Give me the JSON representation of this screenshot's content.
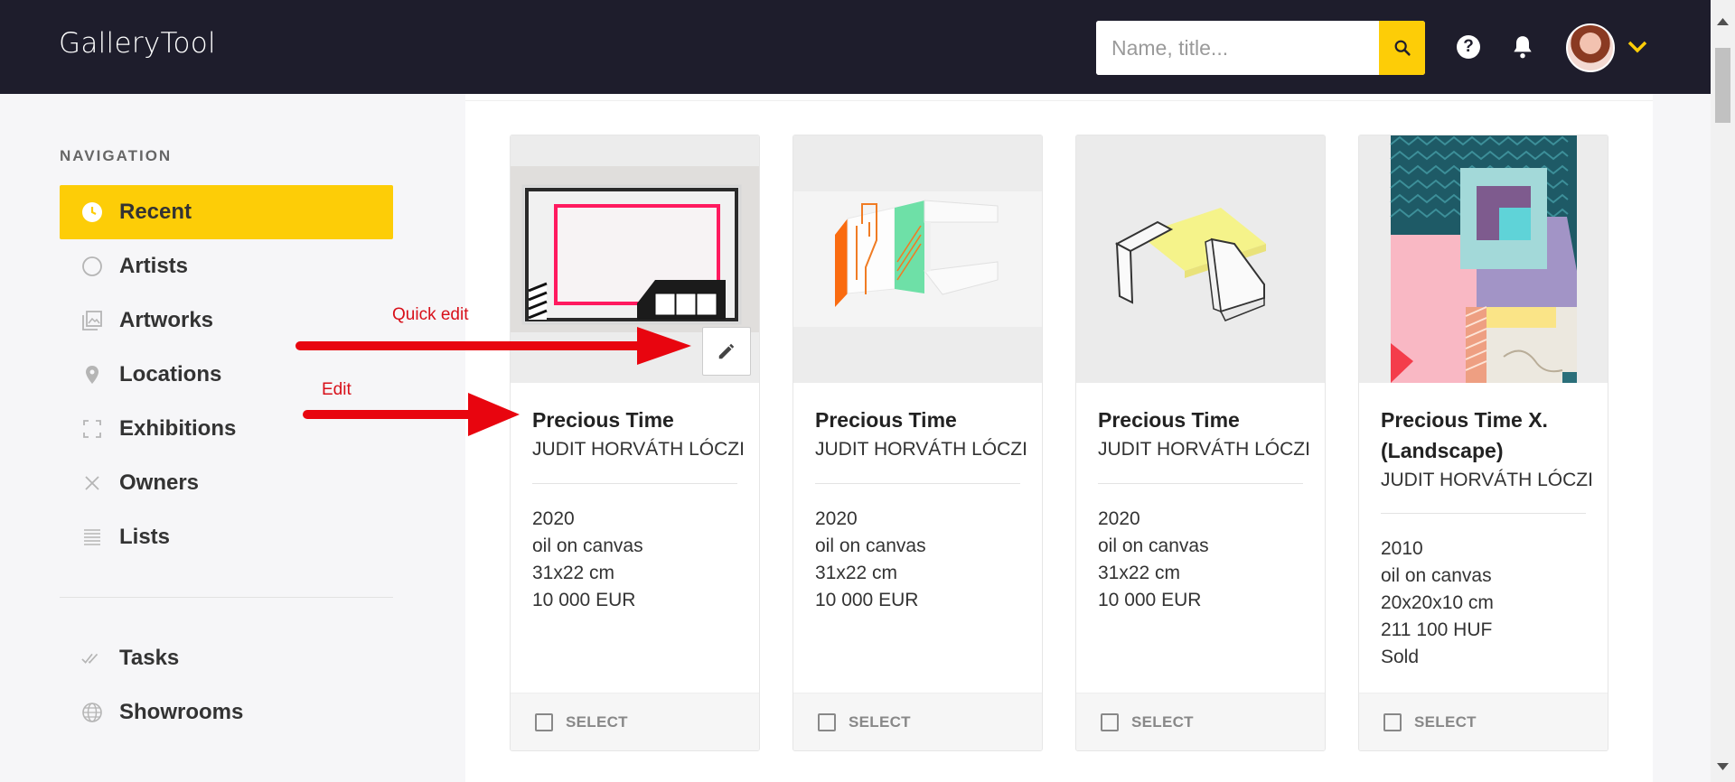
{
  "header": {
    "app_name": "GalleryTool",
    "search_placeholder": "Name, title...",
    "help_label": "?"
  },
  "sidebar": {
    "heading": "NAVIGATION",
    "items": [
      {
        "label": "Recent",
        "icon": "clock-icon",
        "active": true
      },
      {
        "label": "Artists",
        "icon": "circle-icon"
      },
      {
        "label": "Artworks",
        "icon": "image-gallery-icon"
      },
      {
        "label": "Locations",
        "icon": "pin-icon"
      },
      {
        "label": "Exhibitions",
        "icon": "frame-corners-icon"
      },
      {
        "label": "Owners",
        "icon": "x-icon"
      },
      {
        "label": "Lists",
        "icon": "list-lines-icon"
      }
    ],
    "secondary_items": [
      {
        "label": "Tasks",
        "icon": "double-check-icon"
      },
      {
        "label": "Showrooms",
        "icon": "globe-icon"
      }
    ]
  },
  "annotations": {
    "quick_edit": "Quick edit",
    "edit": "Edit"
  },
  "cards": [
    {
      "title": "Precious Time",
      "artist": "JUDIT HORVÁTH LÓCZI",
      "year": "2020",
      "medium": "oil on canvas",
      "size": "31x22 cm",
      "price": "10 000 EUR",
      "status": "",
      "select_label": "SELECT"
    },
    {
      "title": "Precious Time",
      "artist": "JUDIT HORVÁTH LÓCZI",
      "year": "2020",
      "medium": "oil on canvas",
      "size": "31x22 cm",
      "price": "10 000 EUR",
      "status": "",
      "select_label": "SELECT"
    },
    {
      "title": "Precious Time",
      "artist": "JUDIT HORVÁTH LÓCZI",
      "year": "2020",
      "medium": "oil on canvas",
      "size": "31x22 cm",
      "price": "10 000 EUR",
      "status": "",
      "select_label": "SELECT"
    },
    {
      "title": "Precious Time X. (Landscape)",
      "artist": "JUDIT HORVÁTH LÓCZI",
      "year": "2010",
      "medium": "oil on canvas",
      "size": "20x20x10 cm",
      "price": "211 100 HUF",
      "status": "Sold",
      "select_label": "SELECT"
    }
  ],
  "colors": {
    "header_bg": "#1e1d2c",
    "accent": "#fdcd07",
    "annotation_red": "#d8101a"
  }
}
